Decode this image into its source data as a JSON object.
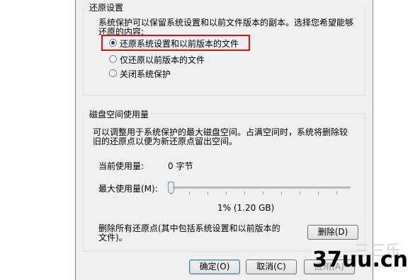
{
  "restore_settings": {
    "legend": "还原设置",
    "description_line1": "系统保护可以保留系统设置和以前文件版本的副本。选择您希望能够",
    "description_line2": "还原的内容:",
    "options": [
      {
        "label": "还原系统设置和以前版本的文件",
        "selected": true
      },
      {
        "label": "仅还原以前版本的文件",
        "selected": false
      },
      {
        "label": "关闭系统保护",
        "selected": false
      }
    ]
  },
  "disk_space": {
    "legend": "磁盘空间使用量",
    "description_line1": "可以调整用于系统保护的最大磁盘空间。占满空间时，系统将删除较",
    "description_line2": "旧的还原点以便为新还原点留出空间。",
    "current_usage_label": "当前使用量:",
    "current_usage_value": "0 字节",
    "max_usage_label": "最大使用量(M):",
    "slider_percent": 1,
    "slider_value_text": "1% (1.20 GB)",
    "delete_text_line1": "删除所有还原点(其中包括系统设置和以前版本的",
    "delete_text_line2": "文件)。",
    "delete_button": "删除(D)"
  },
  "footer": {
    "ok_button": "确定(O)",
    "cancel_button": "取消(C)",
    "apply_button": "应用(A)"
  },
  "watermark": {
    "text": "37uu.cn",
    "faint_text": "三三乐"
  },
  "colors": {
    "highlight_box": "#e01010",
    "dialog_bg": "#f0f0f0"
  }
}
